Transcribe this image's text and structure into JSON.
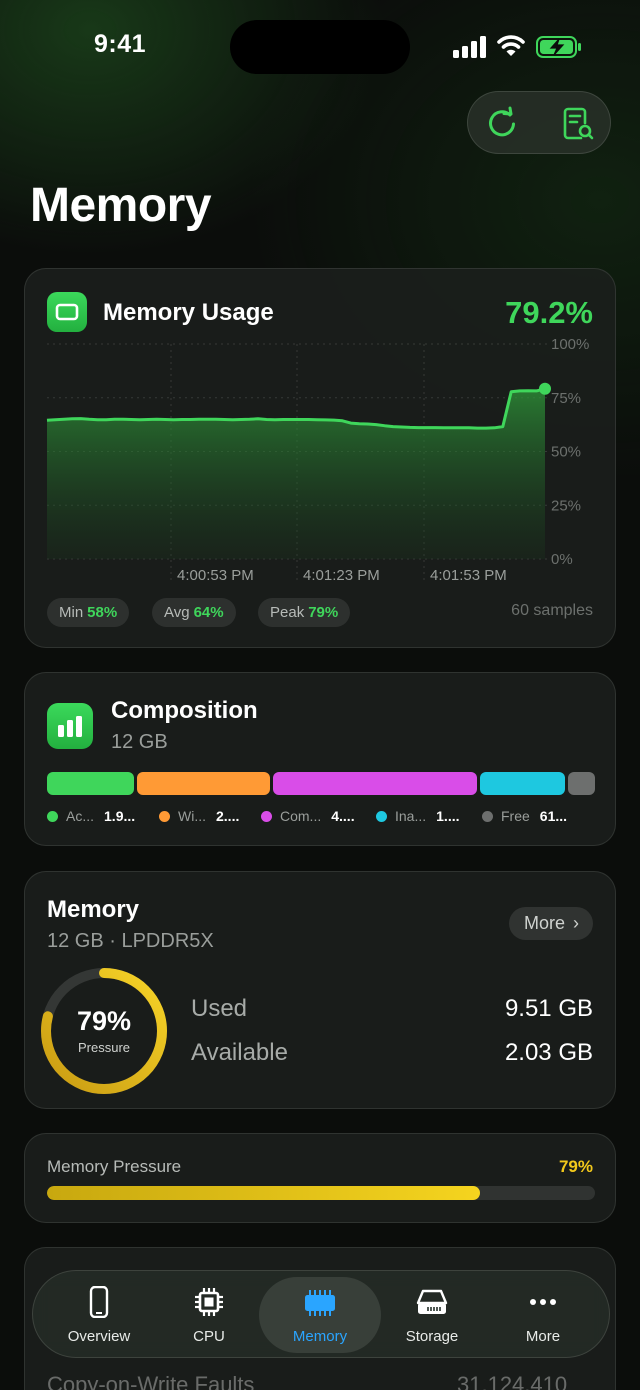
{
  "status": {
    "time": "9:41"
  },
  "page": {
    "title": "Memory"
  },
  "usage": {
    "title": "Memory Usage",
    "percent": "79.2%",
    "min_label": "Min",
    "min_value": "58%",
    "avg_label": "Avg",
    "avg_value": "64%",
    "peak_label": "Peak",
    "peak_value": "79%",
    "samples": "60 samples",
    "chart_data": {
      "type": "area",
      "y_ticks": [
        "100%",
        "75%",
        "50%",
        "25%",
        "0%"
      ],
      "ylim": [
        0,
        100
      ],
      "x_ticks": [
        "4:00:53 PM",
        "4:01:23 PM",
        "4:01:53 PM"
      ],
      "values": [
        64.5,
        64.8,
        65,
        65.2,
        65.3,
        65,
        64.8,
        64.8,
        65,
        65,
        64.9,
        64.8,
        64.9,
        65,
        64.9,
        64.8,
        64.9,
        64.9,
        65,
        65,
        65,
        64.9,
        64.8,
        64.9,
        65,
        65.2,
        64.9,
        64.8,
        64.9,
        64.9,
        64.9,
        64.9,
        64.8,
        64.7,
        64.6,
        64.3,
        63.2,
        62.9,
        62.8,
        62.5,
        62.0,
        61.6,
        61.4,
        61.2,
        61.1,
        61.1,
        61.1,
        61.0,
        61.0,
        61.0,
        61.0,
        60.9,
        60.9,
        61.0,
        61.6,
        77.8,
        78.2,
        78.3,
        78.2,
        79.2
      ],
      "color": "#3fd65b"
    }
  },
  "composition": {
    "title": "Composition",
    "total": "12 GB",
    "segments": [
      {
        "short": "Ac...",
        "value": "1.9...",
        "color": "#3fd65b",
        "fraction": 0.16
      },
      {
        "short": "Wi...",
        "value": "2....",
        "color": "#ff9a35",
        "fraction": 0.245
      },
      {
        "short": "Com...",
        "value": "4....",
        "color": "#d94de8",
        "fraction": 0.375
      },
      {
        "short": "Ina...",
        "value": "1....",
        "color": "#1ec8e0",
        "fraction": 0.155
      },
      {
        "short": "Free",
        "value": "61...",
        "color": "#6d6f6e",
        "fraction": 0.05
      }
    ]
  },
  "memory": {
    "title": "Memory",
    "subtitle": "12 GB · LPDDR5X",
    "more_label": "More",
    "ring_percent": "79%",
    "ring_label": "Pressure",
    "ring_fraction": 0.79,
    "used_label": "Used",
    "used_value": "9.51 GB",
    "available_label": "Available",
    "available_value": "2.03 GB"
  },
  "pressure": {
    "label": "Memory Pressure",
    "value": "79%",
    "fraction": 0.79
  },
  "hidden_row": {
    "label": "Copy-on-Write Faults",
    "value": "31,124,410"
  },
  "tabs": [
    {
      "label": "Overview",
      "icon": "phone-icon"
    },
    {
      "label": "CPU",
      "icon": "cpu-icon"
    },
    {
      "label": "Memory",
      "icon": "memory-chip-icon"
    },
    {
      "label": "Storage",
      "icon": "storage-drive-icon"
    },
    {
      "label": "More",
      "icon": "ellipsis-icon"
    }
  ],
  "colors": {
    "accent_green": "#3fd65b",
    "accent_blue": "#2aa5ff",
    "pressure_yellow": "#f2c81b"
  }
}
